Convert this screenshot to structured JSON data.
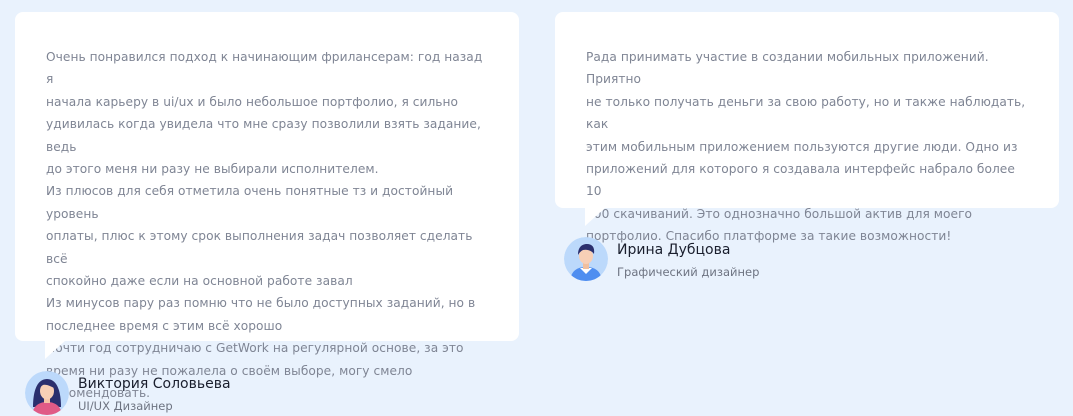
{
  "reviews": [
    {
      "lines": [
        "Очень понравился подход к начинающим фрилансерам: год назад я",
        "начала карьеру в ui/ux и было небольшое портфолио, я сильно",
        "удивилась когда увидела что мне сразу позволили взять задание, ведь",
        "до этого меня ни разу не выбирали исполнителем.",
        "Из плюсов для себя отметила очень понятные тз и достойный уровень",
        "оплаты, плюс к этому срок выполнения задач позволяет сделать всё",
        "спокойно даже если на основной работе завал",
        "Из минусов пару раз помню что не было доступных заданий, но в",
        "последнее время с этим всё хорошо",
        "Почти год сотрудничаю с GetWork на регулярной основе, за это",
        "время ни разу не пожалела о своём выборе, могу смело",
        "рекомендовать."
      ],
      "author": {
        "name": "Виктория Соловьева",
        "role": "UI/UX Дизайнер",
        "avatar_icon": "woman-avatar-icon"
      }
    },
    {
      "lines": [
        "Рада принимать участие в создании мобильных приложений. Приятно",
        "не только получать деньги за свою работу, но и также наблюдать, как",
        "этим мобильным приложением пользуются другие люди. Одно из",
        "приложений для которого я создавала интерфейс набрало более 10",
        "000 скачиваний. Это однозначно большой актив для моего",
        "портфолио. Спасибо платформе за такие возможности!"
      ],
      "author": {
        "name": "Ирина Дубцова",
        "role": "Графический дизайнер",
        "avatar_icon": "man-avatar-icon"
      }
    }
  ],
  "colors": {
    "page_background": "#e9f2fd",
    "card_background": "#ffffff",
    "review_text": "#7f8594",
    "author_name": "#1a1f2e",
    "author_role": "#6d7381"
  }
}
